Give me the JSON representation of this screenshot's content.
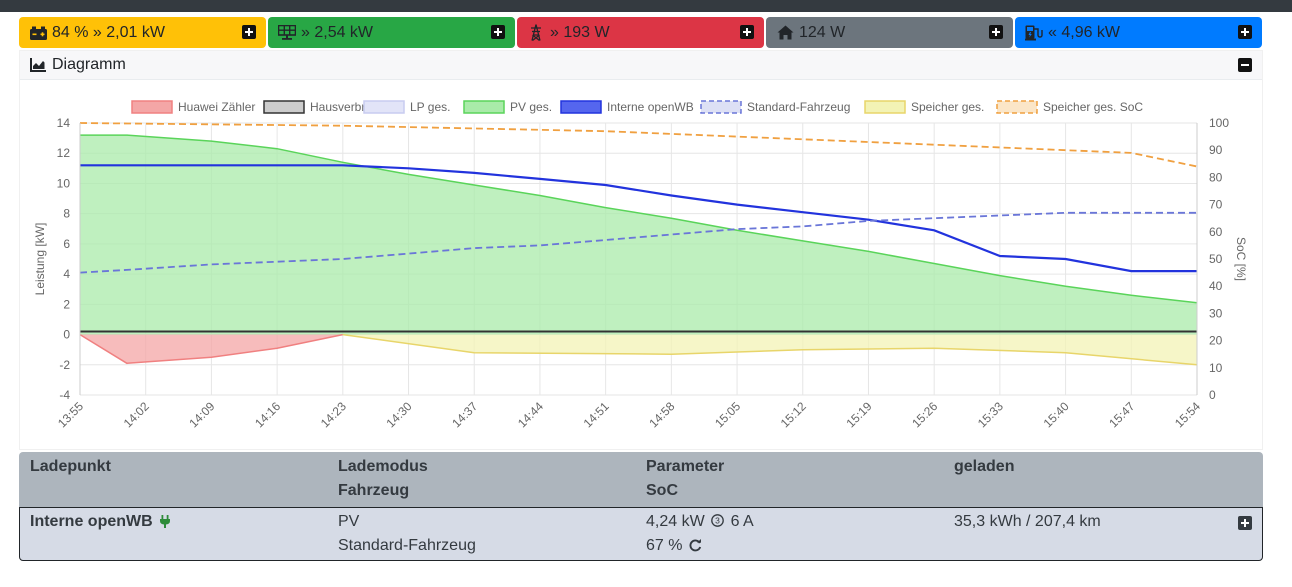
{
  "status_cards": [
    {
      "icon": "car-battery-icon",
      "text": "84 % » 2,01 kW",
      "color": "#ffc107"
    },
    {
      "icon": "solar-panel-icon",
      "text": "» 2,54 kW",
      "color": "#28a745"
    },
    {
      "icon": "power-grid-icon",
      "text": "» 193 W",
      "color": "#dc3545"
    },
    {
      "icon": "house-icon",
      "text": "124 W",
      "color": "#6c757d"
    },
    {
      "icon": "charging-station-icon",
      "text": "« 4,96 kW",
      "color": "#007bff"
    }
  ],
  "chart_card": {
    "title": "Diagramm",
    "icon": "area-chart-icon"
  },
  "chart_data": {
    "type": "area",
    "ylabel_left": "Leistung [kW]",
    "ylabel_right": "SoC [%]",
    "ylim_left": [
      -4,
      14
    ],
    "yticks_left": [
      14,
      12,
      10,
      8,
      6,
      4,
      2,
      0,
      -2,
      -4
    ],
    "ylim_right": [
      0,
      100
    ],
    "yticks_right": [
      100,
      90,
      80,
      70,
      60,
      50,
      40,
      30,
      20,
      10,
      0
    ],
    "x_ticks": [
      "13:55",
      "14:02",
      "14:09",
      "14:16",
      "14:23",
      "14:30",
      "14:37",
      "14:44",
      "14:51",
      "14:58",
      "15:05",
      "15:12",
      "15:19",
      "15:26",
      "15:33",
      "15:40",
      "15:47",
      "15:54"
    ],
    "grid": true,
    "legend_position": "top",
    "legend": [
      {
        "name": "Huawei Zähler",
        "color": "#f08080",
        "fill": "#f4a6a6",
        "dashed": false
      },
      {
        "name": "Hausverbr.",
        "color": "#333333",
        "fill": "#cccccc",
        "dashed": false
      },
      {
        "name": "LP ges.",
        "color": "#c8ccf0",
        "fill": "#e2e4f8",
        "dashed": false
      },
      {
        "name": "PV ges.",
        "color": "#5ad45a",
        "fill": "#a9eba9",
        "dashed": false
      },
      {
        "name": "Interne openWB",
        "color": "#2233dd",
        "fill": "#5566ee",
        "dashed": false
      },
      {
        "name": "Standard-Fahrzeug",
        "color": "#6a76d8",
        "fill": "#dde0f5",
        "dashed": true
      },
      {
        "name": "Speicher ges.",
        "color": "#e8d56a",
        "fill": "#f3f3b5",
        "dashed": false
      },
      {
        "name": "Speicher ges. SoC",
        "color": "#f0a040",
        "fill": "#fbe6c8",
        "dashed": true
      }
    ],
    "series": [
      {
        "name": "PV ges.",
        "x": [
          "13:55",
          "14:00",
          "14:09",
          "14:16",
          "14:23",
          "14:30",
          "14:37",
          "14:44",
          "14:51",
          "14:58",
          "15:05",
          "15:12",
          "15:19",
          "15:26",
          "15:33",
          "15:40",
          "15:47",
          "15:54"
        ],
        "values": [
          13.2,
          13.2,
          12.8,
          12.3,
          11.4,
          10.6,
          9.9,
          9.2,
          8.4,
          7.7,
          6.9,
          6.2,
          5.5,
          4.7,
          3.9,
          3.2,
          2.6,
          2.1
        ]
      },
      {
        "name": "Interne openWB",
        "x": [
          "13:55",
          "14:23",
          "14:30",
          "14:37",
          "14:44",
          "14:51",
          "14:58",
          "15:05",
          "15:12",
          "15:19",
          "15:26",
          "15:33",
          "15:40",
          "15:47",
          "15:54"
        ],
        "values": [
          11.2,
          11.2,
          11.0,
          10.7,
          10.3,
          9.9,
          9.2,
          8.6,
          8.1,
          7.6,
          6.9,
          5.2,
          5.0,
          4.2,
          4.2
        ]
      },
      {
        "name": "Hausverbr.",
        "x": [
          "13:55",
          "15:54"
        ],
        "values": [
          0.2,
          0.2
        ]
      },
      {
        "name": "Huawei Zähler",
        "x": [
          "13:55",
          "14:00",
          "14:09",
          "14:16",
          "14:23"
        ],
        "values": [
          0,
          -1.9,
          -1.5,
          -0.9,
          0
        ]
      },
      {
        "name": "Speicher ges.",
        "x": [
          "14:23",
          "14:37",
          "14:58",
          "15:12",
          "15:26",
          "15:40",
          "15:54"
        ],
        "values": [
          0,
          -1.2,
          -1.3,
          -1.0,
          -0.9,
          -1.2,
          -2.0
        ]
      },
      {
        "name": "Standard-Fahrzeug",
        "axis": "right",
        "x": [
          "13:55",
          "14:00",
          "14:09",
          "14:16",
          "14:23",
          "14:30",
          "14:37",
          "14:44",
          "14:51",
          "14:58",
          "15:05",
          "15:12",
          "15:19",
          "15:26",
          "15:33",
          "15:40",
          "15:47",
          "15:54"
        ],
        "values": [
          45,
          46,
          48,
          49,
          50,
          52,
          54,
          55,
          57,
          59,
          61,
          62,
          64,
          65,
          66,
          67,
          67,
          67
        ]
      },
      {
        "name": "Speicher ges. SoC",
        "axis": "right",
        "x": [
          "13:55",
          "14:23",
          "14:51",
          "15:19",
          "15:47",
          "15:54"
        ],
        "values": [
          100,
          99,
          97,
          93,
          89,
          84
        ]
      }
    ]
  },
  "table": {
    "headers": {
      "col1_line1": "Ladepunkt",
      "col2_line1": "Lademodus",
      "col2_line2": "Fahrzeug",
      "col3_line1": "Parameter",
      "col3_line2": "SoC",
      "col4_line1": "geladen"
    },
    "row": {
      "name": "Interne openWB",
      "plug_icon": "plug-icon",
      "mode": "PV",
      "vehicle": "Standard-Fahrzeug",
      "power": "4,24 kW",
      "phases_icon": "phases-3-icon",
      "current": "6 A",
      "soc": "67 %",
      "refresh_icon": "refresh-icon",
      "charged": "35,3 kWh / 207,4 km"
    }
  }
}
